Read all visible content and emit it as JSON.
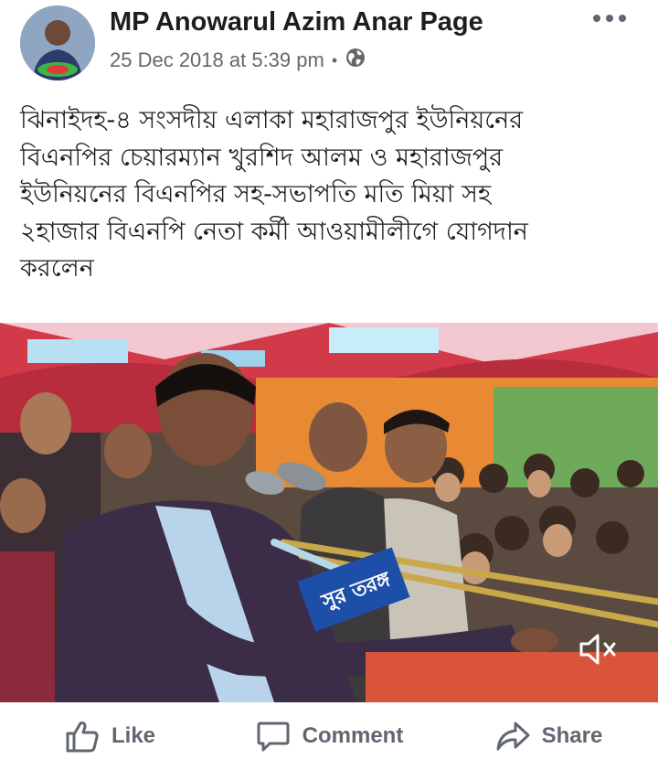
{
  "post": {
    "author": "MP Anowarul Azim Anar Page",
    "timestamp": "25 Dec 2018 at 5:39 pm",
    "separator": "•",
    "privacy_icon": "globe-icon",
    "more_icon": "more-options-icon",
    "text": "ঝিনাইদহ-৪ সংসদীয় এলাকা  মহারাজপুর ইউনিয়নের\nবিএনপির চেয়ারম্যান খুরশিদ আলম ও মহারাজপুর\nইউনিয়নের বিএনপির  সহ-সভাপতি মতি মিয়া সহ\n২হাজার বিএনপি নেতা কর্মী আওয়ামীলীগে যোগদান\nকরলেন",
    "media": {
      "banner_text": "সুর তরঙ্গ",
      "mute_icon": "speaker-muted-icon"
    }
  },
  "actions": {
    "like": "Like",
    "comment": "Comment",
    "share": "Share"
  },
  "colors": {
    "text": "#1c1e21",
    "meta": "#65676b",
    "action": "#606770",
    "tent_red": "#d23a4a"
  }
}
